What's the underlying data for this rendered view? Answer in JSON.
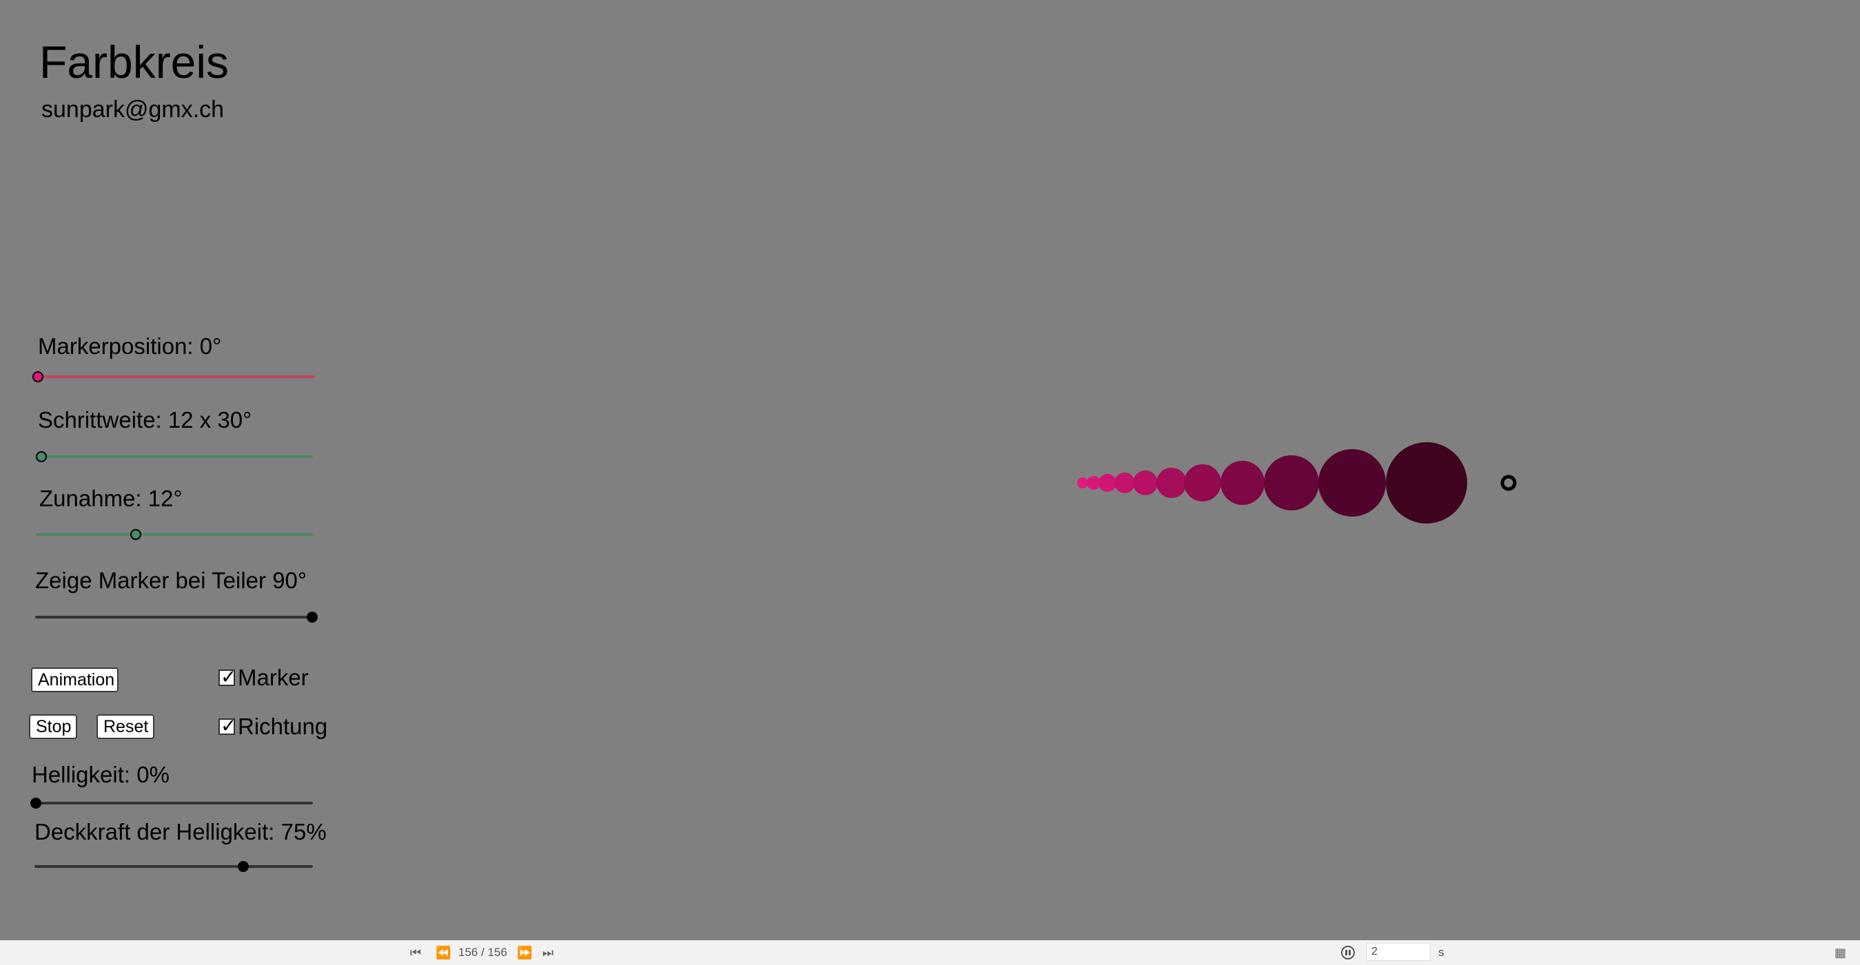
{
  "header": {
    "title": "Farbkreis",
    "author": "sunpark@gmx.ch"
  },
  "controls": {
    "marker_position": {
      "label": "Markerposition: 0°",
      "value": 0,
      "color": "#c0455c"
    },
    "step_width": {
      "label": "Schrittweite: 12 x 30°",
      "value": 0,
      "color": "#4a8a67"
    },
    "increase": {
      "label": "Zunahme: 12°",
      "value": 0.36,
      "color": "#4a8a67"
    },
    "show_marker_divisor": {
      "label": "Zeige Marker bei Teiler 90°",
      "value": 1.0,
      "color": "#333333"
    },
    "animation_button": "Animation",
    "stop_button": "Stop",
    "reset_button": "Reset",
    "marker_checkbox": {
      "label": "Marker",
      "checked": true
    },
    "direction_checkbox": {
      "label": "Richtung",
      "checked": true
    },
    "brightness": {
      "label": "Helligkeit: 0%",
      "value": 0.0,
      "color": "#333333"
    },
    "brightness_opacity": {
      "label": "Deckkraft der Helligkeit: 75%",
      "value": 0.75,
      "color": "#333333"
    }
  },
  "canvas": {
    "circle_colors": [
      "#e3197d",
      "#db1778",
      "#d11573",
      "#c5136c",
      "#b71064",
      "#a60d5a",
      "#930a4f",
      "#7e0744",
      "#670538",
      "#52032c",
      "#3f021f"
    ],
    "marker_ring_color": "#000000"
  },
  "playback": {
    "frame_counter": "156 / 156",
    "speed_value": "2",
    "speed_unit": "s",
    "icons": [
      "skip-to-start-icon",
      "step-back-icon",
      "step-forward-icon",
      "skip-to-end-icon",
      "pause-icon",
      "graphics-view-icon"
    ]
  }
}
